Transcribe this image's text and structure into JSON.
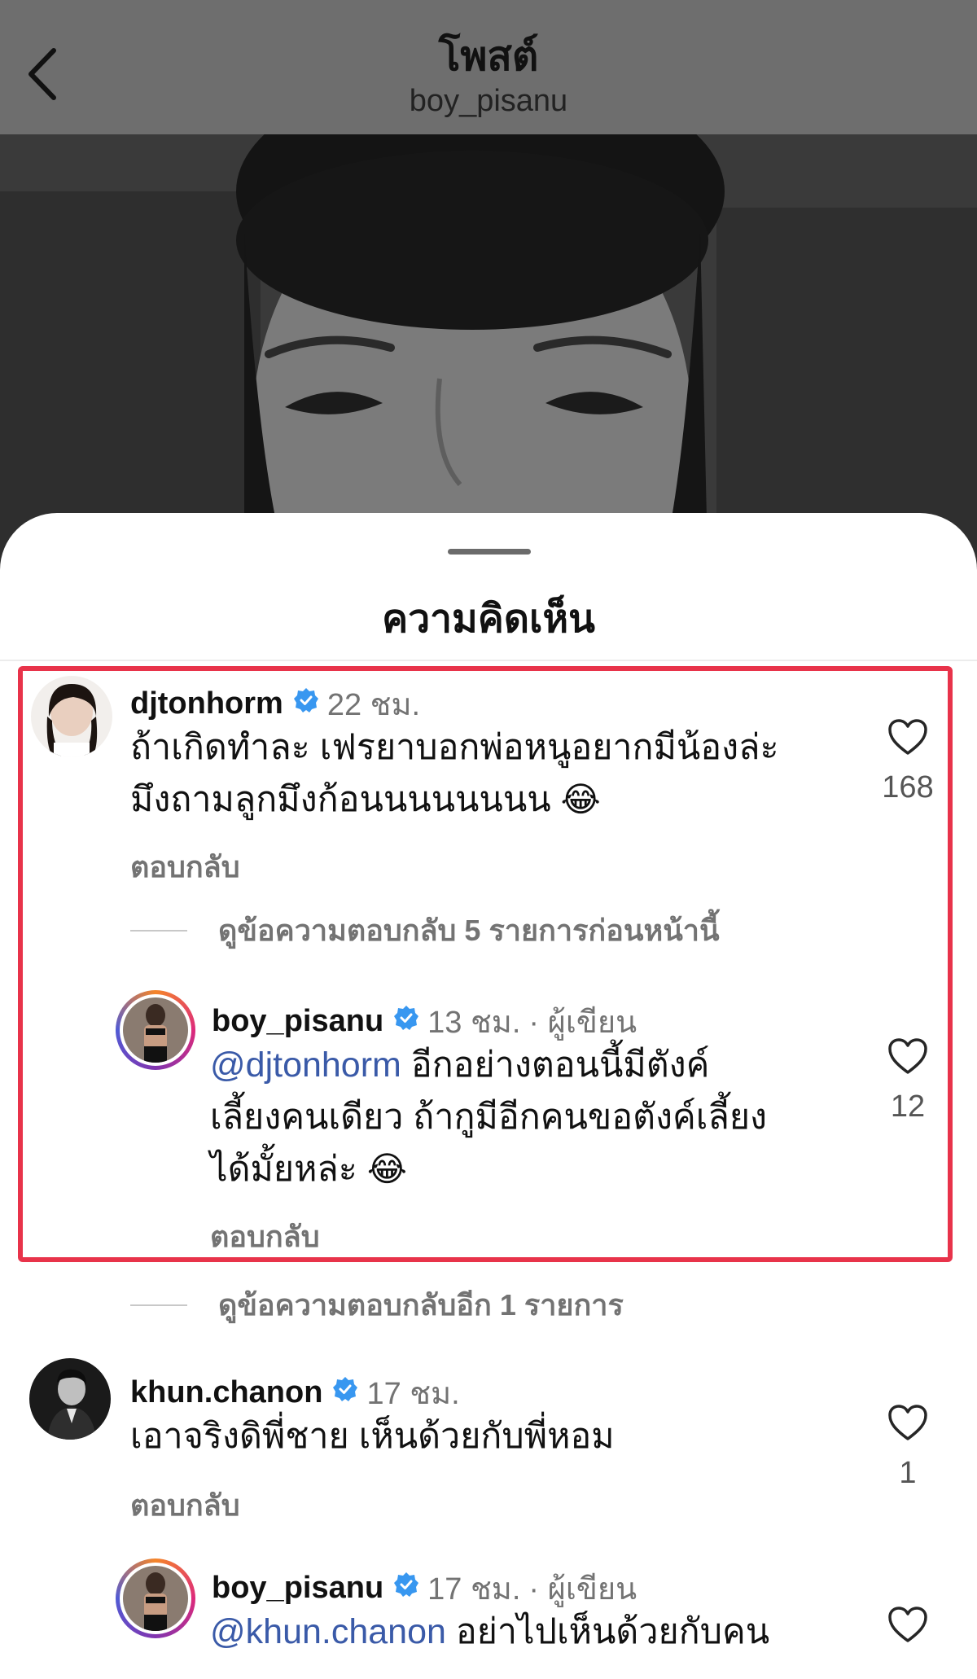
{
  "header": {
    "title": "โพสต์",
    "subtitle": "boy_pisanu"
  },
  "sheet": {
    "title": "ความคิดเห็น"
  },
  "comments": [
    {
      "username": "djtonhorm",
      "time": "22 ชม.",
      "text_line1": "ถ้าเกิดทำละ เฟรยาบอกพ่อหนูอยากมีน้องล่ะ",
      "text_line2": "มึงถามลูกมึงก้อนนนนนนนน",
      "emoji": "😂",
      "reply_label": "ตอบกลับ",
      "likes": "168"
    },
    {
      "username": "boy_pisanu",
      "time": "13 ชม.",
      "author_tag": "· ผู้เขียน",
      "mention": "@djtonhorm",
      "text_line1": " อีกอย่างตอนนี้มีตังค์",
      "text_line2": "เลี้ยงคนเดียว ถ้ากูมีอีกคนขอตังค์เลี้ยง",
      "text_line3": "ได้มั้ยหล่ะ",
      "emoji": "😂",
      "reply_label": "ตอบกลับ",
      "likes": "12"
    },
    {
      "username": "khun.chanon",
      "time": "17 ชม.",
      "text_line1": "เอาจริงดิพี่ชาย เห็นด้วยกับพี่หอม",
      "reply_label": "ตอบกลับ",
      "likes": "1"
    },
    {
      "username": "boy_pisanu",
      "time": "17 ชม.",
      "author_tag": "· ผู้เขียน",
      "mention": "@khun.chanon",
      "text_line1": " อย่าไปเห็นด้วยกับคน"
    }
  ],
  "view_replies": {
    "previous": "ดูข้อความตอบกลับ 5 รายการก่อนหน้านี้",
    "more": "ดูข้อความตอบกลับอีก 1 รายการ"
  },
  "icons": {
    "back": "chevron-left-icon",
    "verified": "verified-badge-icon",
    "like": "heart-outline-icon"
  },
  "colors": {
    "highlight": "#e8334a",
    "verified": "#3897f0",
    "mention": "#3a5aa8"
  }
}
